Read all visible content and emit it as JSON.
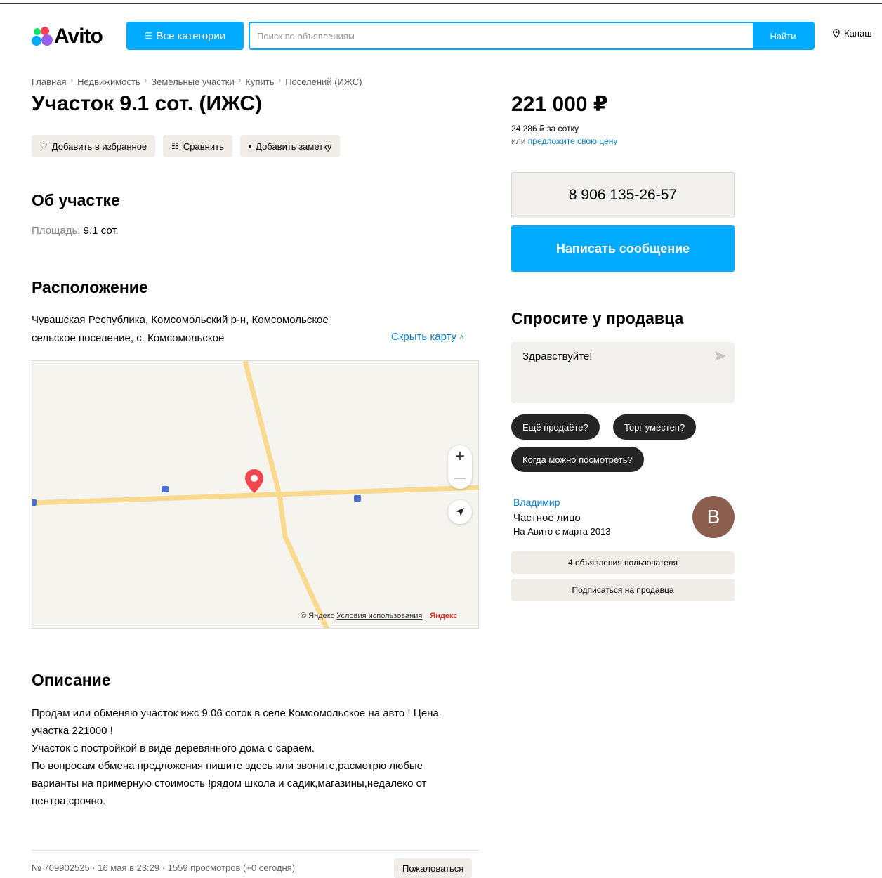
{
  "header": {
    "logo_text": "Avito",
    "categories_label": "Все категории",
    "search_placeholder": "Поиск по объявлениям",
    "search_button": "Найти",
    "location": "Канаш"
  },
  "breadcrumb": [
    "Главная",
    "Недвижимость",
    "Земельные участки",
    "Купить",
    "Поселений (ИЖС)"
  ],
  "title": "Участок 9.1 сот. (ИЖС)",
  "actions": {
    "favorite": "Добавить в избранное",
    "compare": "Сравнить",
    "note": "Добавить заметку"
  },
  "about": {
    "heading": "Об участке",
    "area_label": "Площадь:",
    "area_value": "9.1 сот."
  },
  "location_section": {
    "heading": "Расположение",
    "address_line1": "Чувашская Республика, Комсомольский р-н, Комсомольское",
    "address_line2": "сельское поселение, с. Комсомольское",
    "hide_map": "Скрыть карту"
  },
  "map": {
    "zoom_in": "+",
    "zoom_out": "—",
    "copyright": "© Яндекс",
    "terms": "Условия использования",
    "brand": "Яндекс"
  },
  "description": {
    "heading": "Описание",
    "line1": "Продам или обменяю участок ижс 9.06 соток в селе Комсомольское на авто ! Цена",
    "line2": "участка 221000 !",
    "line3": "Участок с постройкой в виде деревянного дома с сараем.",
    "line4": "По вопросам обмена предложения пишите здесь или звоните,расмотрю любые",
    "line5": "варианты на примерную стоимость !рядом школа и садик,магазины,недалеко от",
    "line6": "центра,срочно."
  },
  "footer": {
    "meta": "№ 709902525 · 16 мая в 23:29 · 1559 просмотров (+0 сегодня)",
    "complain": "Пожаловаться"
  },
  "price": {
    "value": "221 000 ₽",
    "per_unit": "24 286 ₽ за сотку",
    "offer_prefix": "или",
    "offer_link": "предложите свою цену"
  },
  "contact": {
    "phone": "8 906 135-26-57",
    "message_button": "Написать сообщение"
  },
  "ask": {
    "heading": "Спросите у продавца",
    "message": "Здравствуйте!",
    "chips": [
      "Ещё продаёте?",
      "Торг уместен?",
      "Когда можно посмотреть?"
    ]
  },
  "seller": {
    "name": "Владимир",
    "type": "Частное лицо",
    "since": "На Авито с марта 2013",
    "avatar_letter": "В",
    "avatar_color": "#8b5e4e",
    "listings_button": "4 объявления пользователя",
    "subscribe_button": "Подписаться на продавца"
  },
  "colors": {
    "accent": "#00aaff",
    "link": "#0a7cc4",
    "map_road": "#f9d98d",
    "map_pin": "#f2474e"
  }
}
